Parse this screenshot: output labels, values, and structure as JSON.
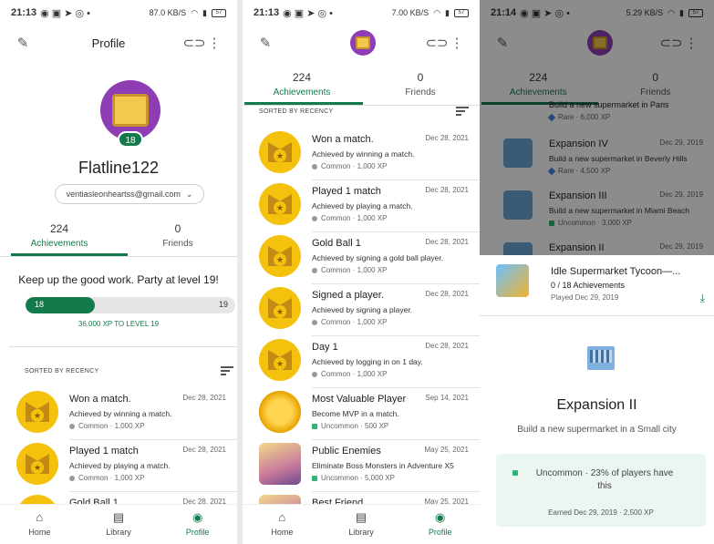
{
  "status": {
    "left_time": "21:13",
    "mid_time": "21:13",
    "right_time": "21:14",
    "speed1": "87.0 KB/S",
    "speed2": "7.00 KB/S",
    "speed3": "5.29 KB/S",
    "battery": "57"
  },
  "profile": {
    "title": "Profile",
    "level": "18",
    "username": "Flatline122",
    "email": "ventiasleonheartss@gmail.com",
    "tabs": [
      {
        "count": "224",
        "label": "Achievements"
      },
      {
        "count": "0",
        "label": "Friends"
      }
    ],
    "level_message": "Keep up the good work. Party at level 19!",
    "xp_from": "18",
    "xp_to": "19",
    "xp_progress": 0.33,
    "xp_caption": "36,000 XP TO LEVEL 19",
    "sorted_label": "SORTED BY RECENCY"
  },
  "achievements_left": [
    {
      "name": "Won a match.",
      "date": "Dec 28, 2021",
      "desc": "Achieved by winning a match.",
      "rarity": "Common · 1,000 XP"
    },
    {
      "name": "Played 1 match",
      "date": "Dec 28, 2021",
      "desc": "Achieved by playing a match.",
      "rarity": "Common · 1,000 XP"
    },
    {
      "name": "Gold Ball 1",
      "date": "Dec 28, 2021",
      "desc": "",
      "rarity": ""
    }
  ],
  "achievements_mid": {
    "sorted_label": "SORTED BY RECENCY",
    "items": [
      {
        "name": "Won a match.",
        "date": "Dec 28, 2021",
        "desc": "Achieved by winning a match.",
        "rarity": "Common · 1,000 XP",
        "dot": "grey",
        "icon": "medal-icon"
      },
      {
        "name": "Played 1 match",
        "date": "Dec 28, 2021",
        "desc": "Achieved by playing a match.",
        "rarity": "Common · 1,000 XP",
        "dot": "grey",
        "icon": "medal-icon"
      },
      {
        "name": "Gold Ball 1",
        "date": "Dec 28, 2021",
        "desc": "Achieved by signing a gold ball player.",
        "rarity": "Common · 1,000 XP",
        "dot": "grey",
        "icon": "medal-icon"
      },
      {
        "name": "Signed a player.",
        "date": "Dec 28, 2021",
        "desc": "Achieved by signing a player.",
        "rarity": "Common · 1,000 XP",
        "dot": "grey",
        "icon": "medal-icon"
      },
      {
        "name": "Day 1",
        "date": "Dec 28, 2021",
        "desc": "Achieved by logging in on 1 day.",
        "rarity": "Common · 1,000 XP",
        "dot": "grey",
        "icon": "medal-icon"
      },
      {
        "name": "Most Valuable Player",
        "date": "Sep 14, 2021",
        "desc": "Become MVP in a match.",
        "rarity": "Uncommon · 500 XP",
        "dot": "green",
        "icon": "sun-icon"
      },
      {
        "name": "Public Enemies",
        "date": "May 25, 2021",
        "desc": "Eliminate Boss Monsters in Adventure X5",
        "rarity": "Uncommon · 5,000 XP",
        "dot": "green",
        "icon": "hero-icon"
      },
      {
        "name": "Best Friend",
        "date": "May 25, 2021",
        "desc": "",
        "rarity": "",
        "dot": "grey",
        "icon": "hero-icon"
      }
    ]
  },
  "dimmed": {
    "top_row_text": "Build a new supermarket in Paris",
    "top_row_rarity": "Rare · 6,000 XP",
    "items": [
      {
        "name": "Expansion IV",
        "date": "Dec 29, 2019",
        "desc": "Build a new supermarket in Beverly Hills",
        "rarity": "Rare · 4,500 XP",
        "dot": "blue"
      },
      {
        "name": "Expansion III",
        "date": "Dec 29, 2019",
        "desc": "Build a new supermarket in Miami Beach",
        "rarity": "Uncommon · 3,000 XP",
        "dot": "green"
      },
      {
        "name": "Expansion II",
        "date": "Dec 29, 2019",
        "desc": "",
        "rarity": "",
        "dot": "green"
      }
    ]
  },
  "sheet": {
    "game_title": "Idle Supermarket Tycoon—...",
    "game_progress": "0 / 18 Achievements",
    "game_played": "Played Dec 29, 2019",
    "title": "Expansion II",
    "desc": "Build a new supermarket in a Small city",
    "rarity_line1": "Uncommon · 23% of players have",
    "rarity_line2": "this",
    "earned": "Earned Dec 29, 2019 · 2,500 XP"
  },
  "nav": [
    {
      "label": "Home",
      "icon": "home-icon"
    },
    {
      "label": "Library",
      "icon": "library-icon"
    },
    {
      "label": "Profile",
      "icon": "profile-icon"
    }
  ],
  "colors": {
    "accent": "#137a4c",
    "medal": "#f4c20d"
  }
}
